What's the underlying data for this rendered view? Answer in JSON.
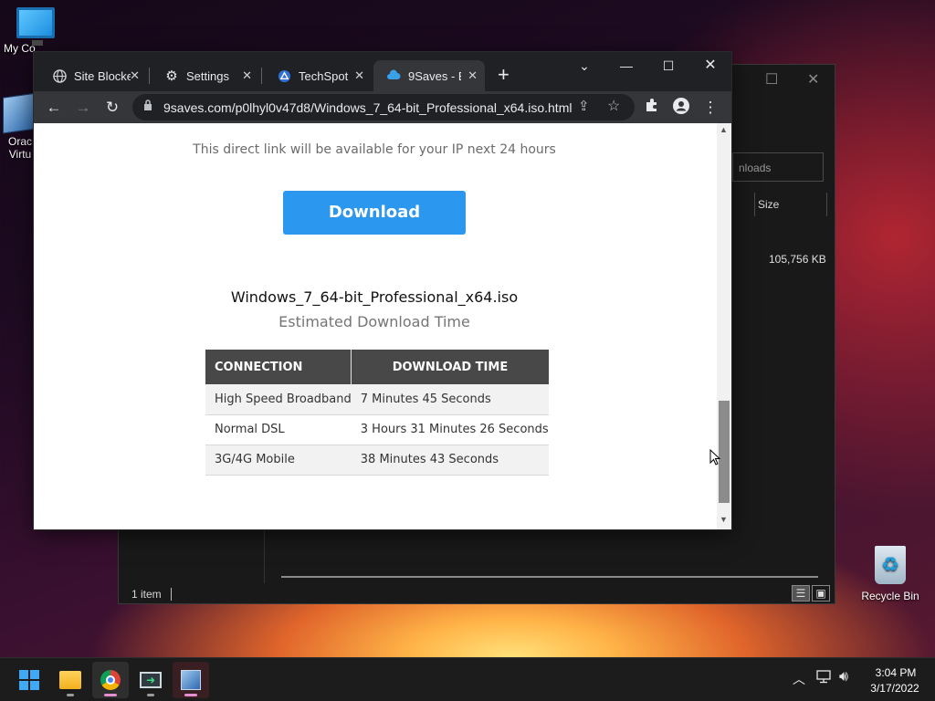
{
  "desktop": {
    "icons": [
      {
        "label": "My Co"
      },
      {
        "label": "Orac Virtu"
      },
      {
        "label": "Recycle Bin"
      }
    ]
  },
  "explorer": {
    "search_placeholder": "nloads",
    "size_header": "Size",
    "file_size": "105,756 KB",
    "status_count": "1 item"
  },
  "browser": {
    "tabs": [
      {
        "title": "Site Blocke",
        "icon": "globe-icon",
        "active": false
      },
      {
        "title": "Settings",
        "icon": "gear-icon",
        "active": false
      },
      {
        "title": "TechSpot |",
        "icon": "techspot-icon",
        "active": false
      },
      {
        "title": "9Saves - E",
        "icon": "cloud-icon",
        "active": true
      }
    ],
    "url": "9saves.com/p0lhyl0v47d8/Windows_7_64-bit_Professional_x64.iso.html"
  },
  "page": {
    "availability_note": "This direct link will be available for your IP next 24 hours",
    "download_label": "Download",
    "file_name": "Windows_7_64-bit_Professional_x64.iso",
    "estimate_heading": "Estimated Download Time",
    "table": {
      "headers": [
        "CONNECTION",
        "DOWNLOAD TIME"
      ],
      "rows": [
        [
          "High Speed Broadband",
          "7 Minutes 45 Seconds"
        ],
        [
          "Normal DSL",
          "3 Hours 31 Minutes 26 Seconds"
        ],
        [
          "3G/4G Mobile",
          "38 Minutes 43 Seconds"
        ]
      ]
    }
  },
  "taskbar": {
    "time": "3:04 PM",
    "date": "3/17/2022",
    "apps": [
      "windows-start",
      "file-explorer",
      "chrome",
      "remote-desktop",
      "virtualbox"
    ]
  },
  "colors": {
    "download_button": "#2c97ee",
    "table_header": "#484848",
    "tabstrip": "#202124",
    "toolbar": "#35363a"
  }
}
